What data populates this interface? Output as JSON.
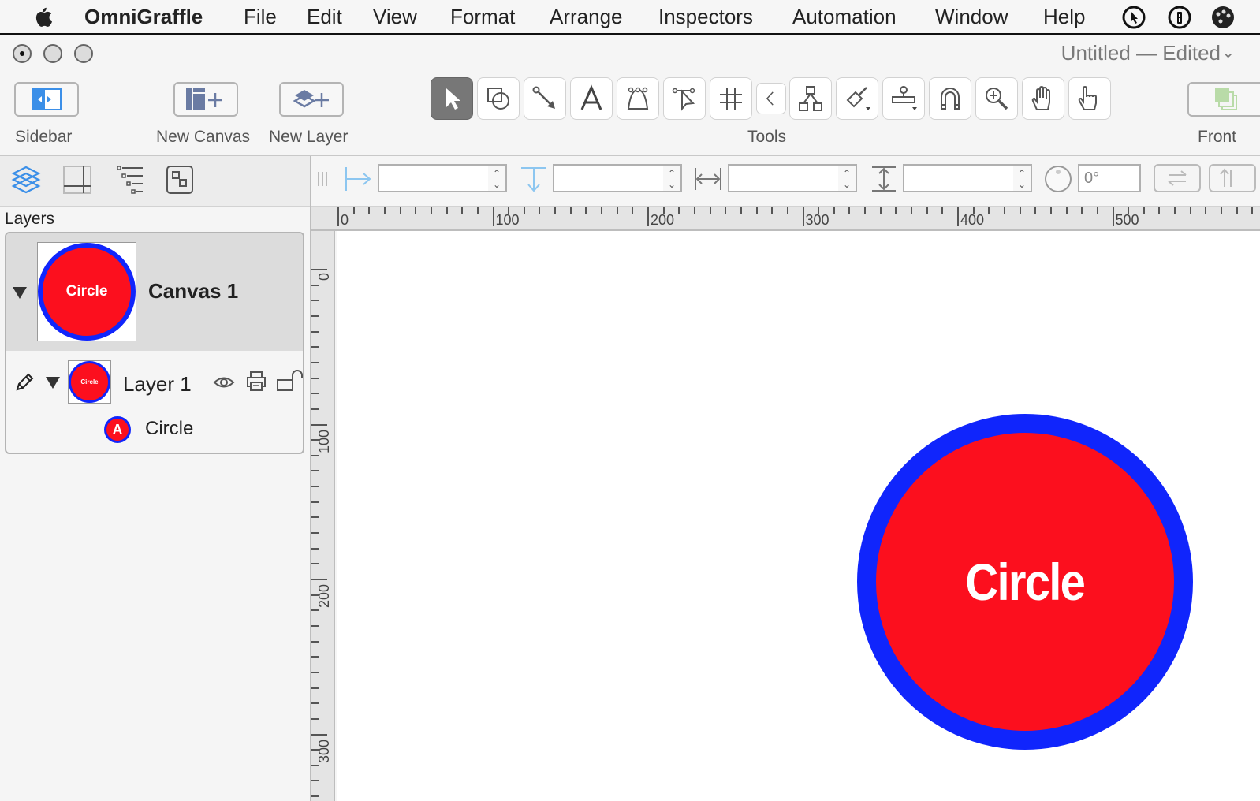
{
  "menubar": {
    "app_name": "OmniGraffle",
    "items": [
      "File",
      "Edit",
      "View",
      "Format",
      "Arrange",
      "Inspectors",
      "Automation",
      "Window",
      "Help"
    ],
    "extras": [
      "cursor-icon",
      "info-icon",
      "palette-icon"
    ]
  },
  "window": {
    "title": "Untitled — Edited"
  },
  "toolbar": {
    "sidebar_label": "Sidebar",
    "new_canvas_label": "New Canvas",
    "new_layer_label": "New Layer",
    "tools_label": "Tools",
    "front_label": "Front",
    "tools": [
      {
        "name": "selection-tool",
        "active": true
      },
      {
        "name": "shape-tool",
        "active": false
      },
      {
        "name": "line-tool",
        "active": false
      },
      {
        "name": "text-tool",
        "active": false
      },
      {
        "name": "pen-tool",
        "active": false
      },
      {
        "name": "point-editor-tool",
        "active": false
      },
      {
        "name": "diagram-grid-tool",
        "active": false
      },
      {
        "name": "collapse-tools",
        "active": false
      },
      {
        "name": "diagram-tool",
        "active": false
      },
      {
        "name": "style-brush-tool",
        "active": false
      },
      {
        "name": "rubber-stamp-tool",
        "active": false
      },
      {
        "name": "magnet-tool",
        "active": false
      },
      {
        "name": "zoom-tool",
        "active": false
      },
      {
        "name": "hand-tool",
        "active": false
      },
      {
        "name": "browse-tool",
        "active": false
      }
    ]
  },
  "sidebar": {
    "tabs": [
      "layers-tab",
      "canvas-grid-tab",
      "outline-tab",
      "selection-tab"
    ],
    "section_title": "Layers",
    "canvas": {
      "name": "Canvas 1",
      "thumb_text": "Circle"
    },
    "layer": {
      "name": "Layer 1",
      "thumb_text": "Circle"
    },
    "objects": [
      {
        "name": "Circle",
        "badge": "A"
      }
    ]
  },
  "inspector_bar": {
    "x_value": "",
    "y_value": "",
    "width_value": "",
    "height_value": "",
    "rotation_value": "0°"
  },
  "rulers": {
    "horizontal_labels": [
      "0",
      "100",
      "200",
      "300",
      "400",
      "500"
    ],
    "vertical_labels": [
      "0",
      "100",
      "200",
      "300"
    ]
  },
  "canvas": {
    "shape": {
      "type": "circle",
      "text": "Circle",
      "fill": "#fc0f1e",
      "stroke": "#1025fc",
      "text_color": "#ffffff"
    }
  }
}
